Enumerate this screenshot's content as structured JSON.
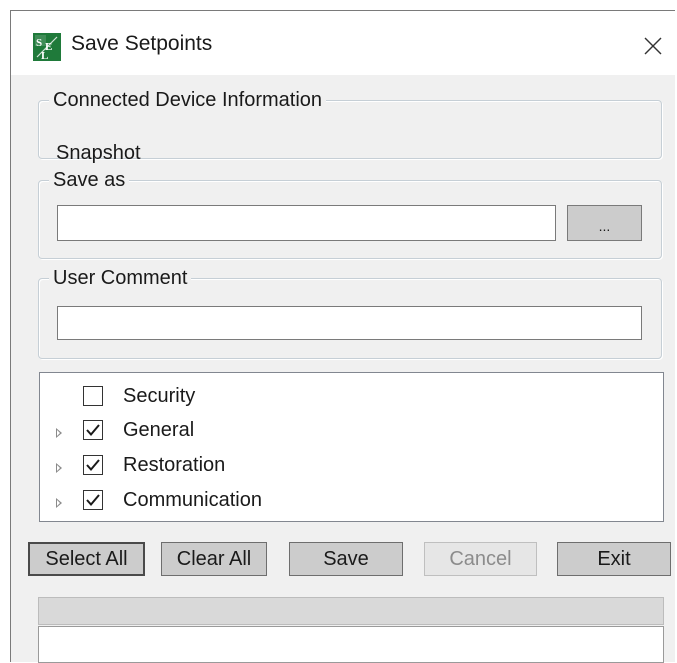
{
  "window": {
    "title": "Save Setpoints",
    "icon": "sel-logo-icon",
    "close_icon": "close-icon"
  },
  "device_info": {
    "legend": "Connected Device Information",
    "value": "Snapshot"
  },
  "save_as": {
    "legend": "Save as",
    "value": "",
    "browse_label": "..."
  },
  "user_comment": {
    "legend": "User Comment",
    "value": ""
  },
  "tree": {
    "items": [
      {
        "label": "Security",
        "checked": false,
        "expandable": false
      },
      {
        "label": "General",
        "checked": true,
        "expandable": true
      },
      {
        "label": "Restoration",
        "checked": true,
        "expandable": true
      },
      {
        "label": "Communication",
        "checked": true,
        "expandable": true
      }
    ]
  },
  "buttons": {
    "select_all": "Select All",
    "clear_all": "Clear All",
    "save": "Save",
    "cancel": "Cancel",
    "exit": "Exit"
  },
  "progress": {
    "value": 0
  },
  "status": {
    "text": ""
  },
  "colors": {
    "window_bg": "#f0f0f0",
    "button_bg": "#cccccc",
    "logo_green": "#1f7a3a"
  }
}
